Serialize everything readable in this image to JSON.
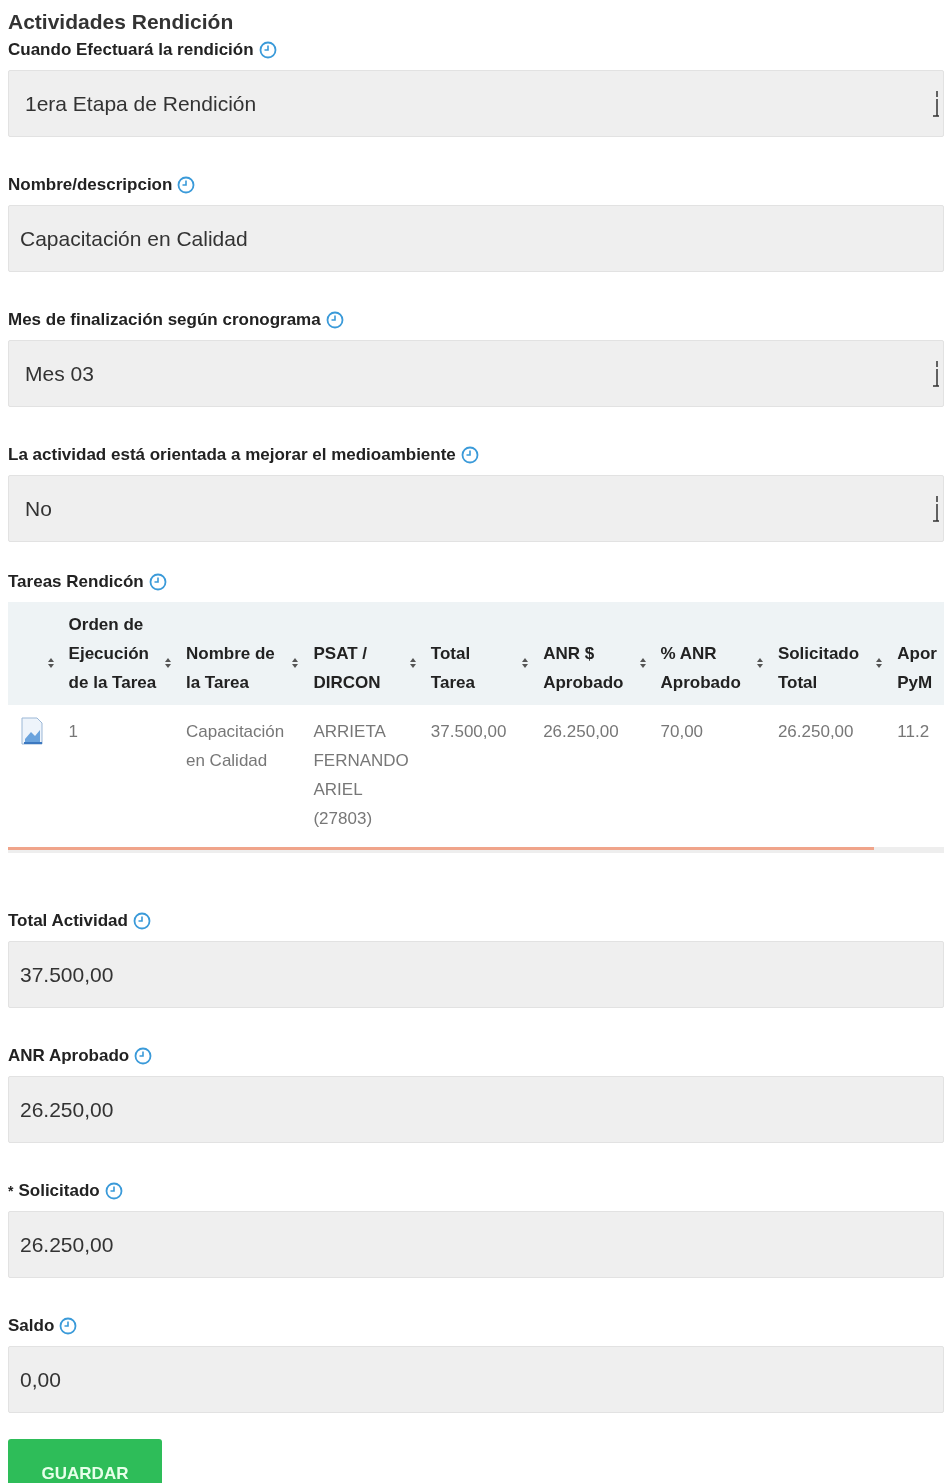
{
  "section_title": "Actividades Rendición",
  "fields_top": [
    {
      "label": "Cuando Efectuará la rendición",
      "kind": "select",
      "value": "1era Etapa de Rendición"
    },
    {
      "label": "Nombre/descripcion",
      "kind": "text",
      "value": "Capacitación en Calidad"
    },
    {
      "label": "Mes de finalización según cronograma",
      "kind": "select",
      "value": "Mes 03"
    },
    {
      "label": "La actividad está orientada a mejorar el medioambiente",
      "kind": "select",
      "value": "No"
    }
  ],
  "table": {
    "title": "Tareas Rendicón",
    "columns": [
      {
        "kind": "icon",
        "sortable": true
      },
      {
        "label": "Orden de Ejecución de la Tarea",
        "sortable": true
      },
      {
        "label": "Nombre de la Tarea",
        "sortable": true
      },
      {
        "label": "PSAT / DIRCON",
        "sortable": true
      },
      {
        "label": "Total Tarea",
        "sortable": true
      },
      {
        "label": "ANR $ Aprobado",
        "sortable": true
      },
      {
        "label": "% ANR Aprobado",
        "sortable": true
      },
      {
        "label": "Solicitado Total",
        "sortable": true
      },
      {
        "label": "Apor PyM",
        "sortable": false
      }
    ],
    "rows": [
      {
        "cells": [
          "",
          "1",
          "Capacitación en Calidad",
          "ARRIETA FERNANDO ARIEL (27803)",
          "37.500,00",
          "26.250,00",
          "70,00",
          "26.250,00",
          "11.2"
        ]
      }
    ]
  },
  "fields_bottom": [
    {
      "label": "Total Actividad",
      "kind": "text",
      "value": "37.500,00"
    },
    {
      "label": "ANR Aprobado",
      "kind": "text",
      "value": "26.250,00"
    },
    {
      "required_mark": "*",
      "label": "Solicitado",
      "kind": "text",
      "value": "26.250,00"
    },
    {
      "label": "Saldo",
      "kind": "text",
      "value": "0,00"
    }
  ],
  "save_button": "GUARDAR"
}
